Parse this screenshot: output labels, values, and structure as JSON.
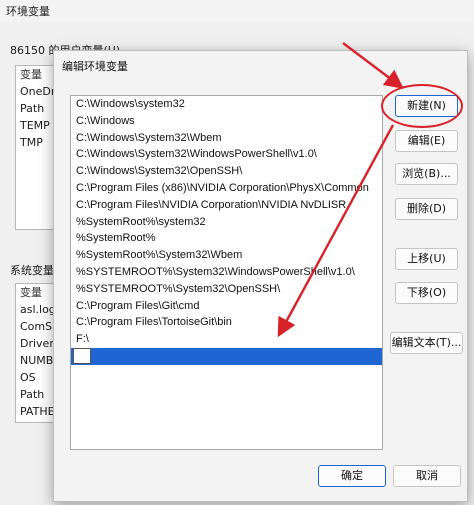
{
  "background_window": {
    "title": "环境变量",
    "user_vars_label": "86150 的用户变量(U)",
    "user_vars": [
      "变量",
      "OneDri",
      "Path",
      "TEMP",
      "TMP"
    ],
    "system_vars_label": "系统变量(",
    "system_vars": [
      "变量",
      "asl.log",
      "ComSp",
      "DriverD",
      "NUMBE",
      "OS",
      "Path",
      "PATHEX"
    ]
  },
  "dialog": {
    "title": "编辑环境变量",
    "paths": [
      "C:\\Windows\\system32",
      "C:\\Windows",
      "C:\\Windows\\System32\\Wbem",
      "C:\\Windows\\System32\\WindowsPowerShell\\v1.0\\",
      "C:\\Windows\\System32\\OpenSSH\\",
      "C:\\Program Files (x86)\\NVIDIA Corporation\\PhysX\\Common",
      "C:\\Program Files\\NVIDIA Corporation\\NVIDIA NvDLISR",
      "%SystemRoot%\\system32",
      "%SystemRoot%",
      "%SystemRoot%\\System32\\Wbem",
      "%SYSTEMROOT%\\System32\\WindowsPowerShell\\v1.0\\",
      "%SYSTEMROOT%\\System32\\OpenSSH\\",
      "C:\\Program Files\\Git\\cmd",
      "C:\\Program Files\\TortoiseGit\\bin",
      "F:\\"
    ],
    "new_entry_value": "",
    "buttons": {
      "new": "新建(N)",
      "edit": "编辑(E)",
      "browse": "浏览(B)...",
      "delete": "删除(D)",
      "move_up": "上移(U)",
      "move_down": "下移(O)",
      "edit_text": "编辑文本(T)...",
      "ok": "确定",
      "cancel": "取消"
    }
  },
  "annotation_color": "#d8222a",
  "selection_color": "#1f66d3"
}
